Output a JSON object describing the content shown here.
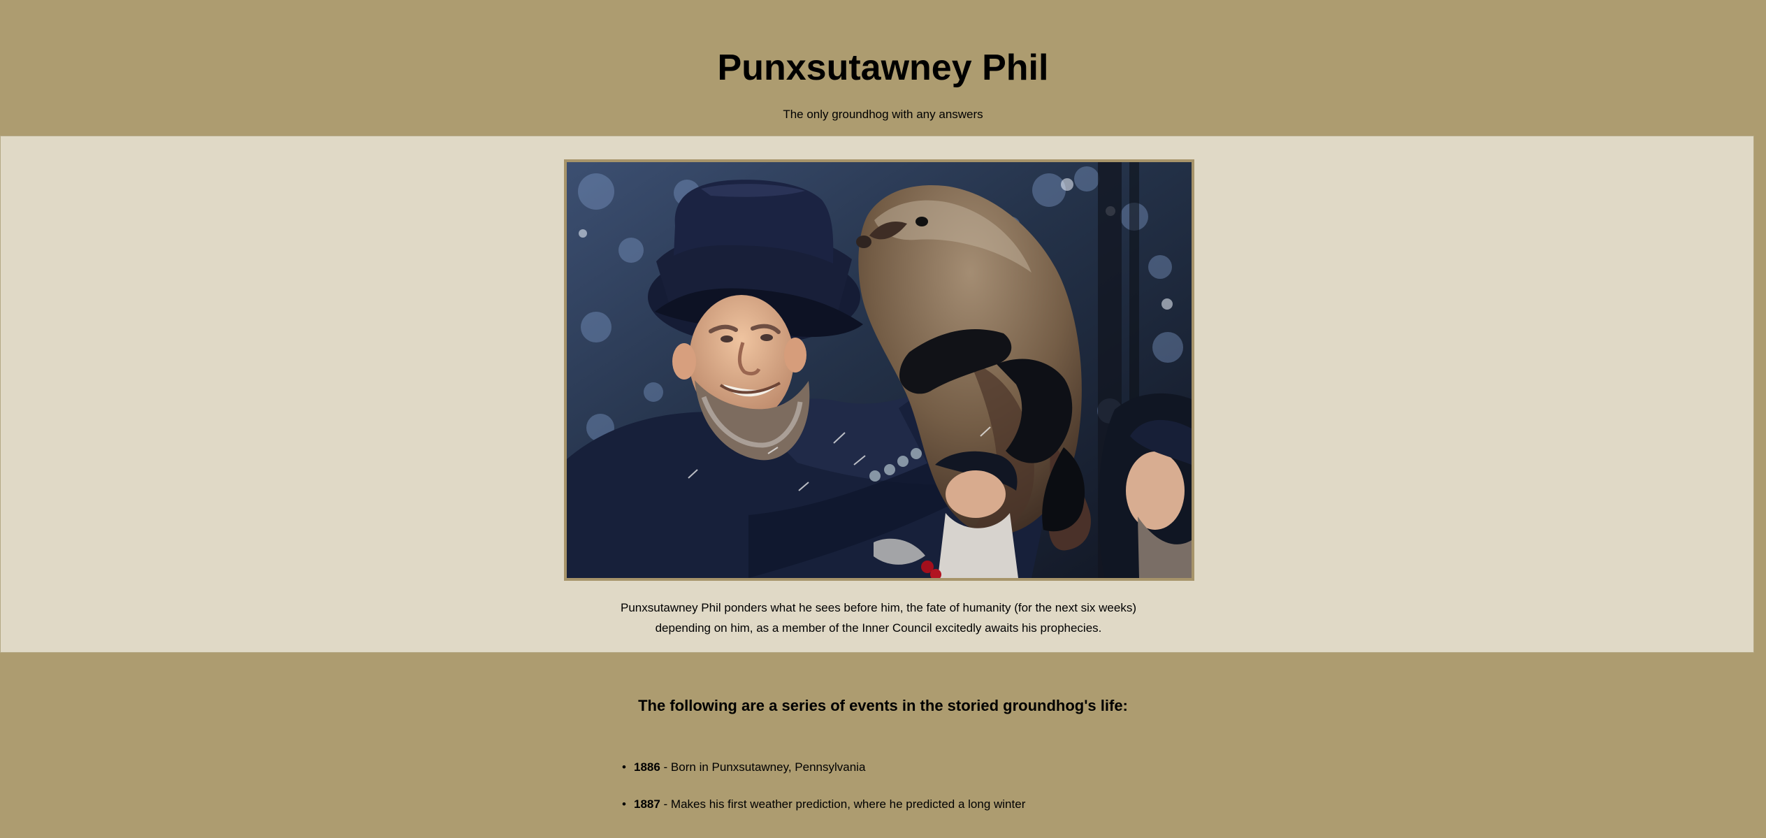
{
  "header": {
    "title": "Punxsutawney Phil",
    "subtitle": "The only groundhog with any answers"
  },
  "hero": {
    "caption": "Punxsutawney Phil ponders what he sees before him, the fate of humanity (for the next six weeks) depending on him, as a member of the Inner Council excitedly awaits his prophecies."
  },
  "timeline": {
    "heading": "The following are a series of events in the storied groundhog's life:",
    "events": [
      {
        "year": "1886",
        "text": " - Born in Punxsutawney, Pennsylvania"
      },
      {
        "year": "1887",
        "text": " - Makes his first weather prediction, where he predicted a long winter"
      }
    ]
  },
  "colors": {
    "page_background": "#ad9c70",
    "hero_background": "#e0d9c6",
    "photo_border": "#a7946a"
  }
}
